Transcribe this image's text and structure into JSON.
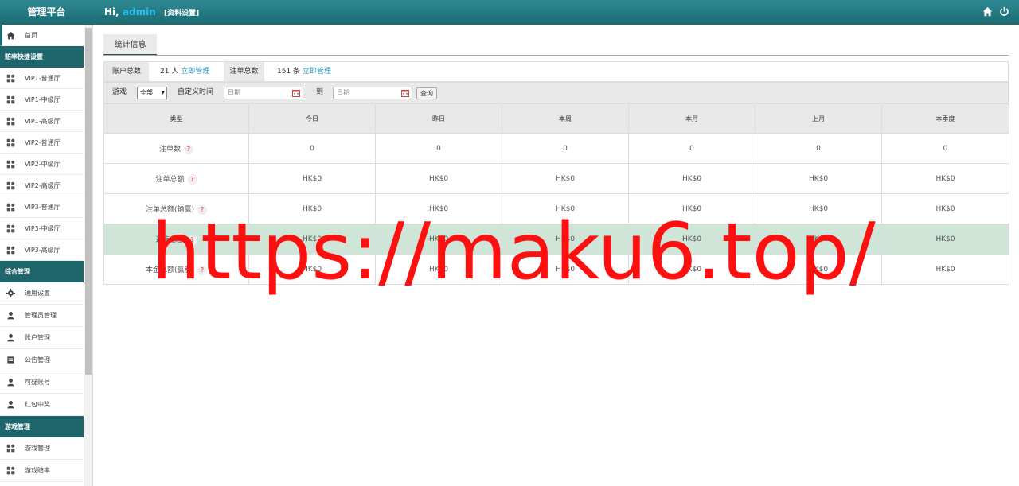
{
  "header": {
    "brand": "管理平台",
    "greeting": "Hi,",
    "user": "admin",
    "profile_link": "[资料设置]"
  },
  "sidebar": {
    "home": "首页",
    "sections": [
      {
        "title": "赔率快捷设置",
        "items": [
          "VIP1-普通厅",
          "VIP1-中级厅",
          "VIP1-高级厅",
          "VIP2-普通厅",
          "VIP2-中级厅",
          "VIP2-高级厅",
          "VIP3-普通厅",
          "VIP3-中级厅",
          "VIP3-高级厅"
        ]
      },
      {
        "title": "综合管理",
        "items": [
          "通用设置",
          "管理员管理",
          "账户管理",
          "公告管理",
          "可疑账号",
          "红包中奖"
        ]
      },
      {
        "title": "游戏管理",
        "items": [
          "游戏管理",
          "游戏赔率"
        ]
      }
    ]
  },
  "tab": "统计信息",
  "summary": {
    "accounts_label": "账户总数",
    "accounts_value": "21 人",
    "accounts_link": "立即管理",
    "orders_label": "注单总数",
    "orders_value": "151 条",
    "orders_link": "立即管理"
  },
  "filter": {
    "game_label": "游戏",
    "game_selected": "全部",
    "custom_time_label": "自定义时间",
    "date_placeholder": "日期",
    "to_label": "到",
    "query_button": "查询"
  },
  "table": {
    "headers": [
      "类型",
      "今日",
      "昨日",
      "本周",
      "本月",
      "上月",
      "本季度"
    ],
    "rows": [
      {
        "label": "注单数",
        "values": [
          "0",
          "0",
          "0",
          "0",
          "0",
          "0"
        ]
      },
      {
        "label": "注单总额",
        "values": [
          "HK$0",
          "HK$0",
          "HK$0",
          "HK$0",
          "HK$0",
          "HK$0"
        ]
      },
      {
        "label": "注单总额(输赢)",
        "values": [
          "HK$0",
          "HK$0",
          "HK$0",
          "HK$0",
          "HK$0",
          "HK$0"
        ]
      },
      {
        "label": "返点总额",
        "values": [
          "HK$0",
          "HK$0",
          "HK$0",
          "HK$0",
          "HK$0",
          "HK$0"
        ]
      },
      {
        "label": "本金总额(赢利)",
        "values": [
          "HK$0",
          "HK$0",
          "HK$0",
          "HK$0",
          "HK$0",
          "HK$0"
        ]
      }
    ],
    "help_mark": "?"
  },
  "watermark": "https://maku6.top/",
  "colors": {
    "header": "#1c6a72",
    "sidebar_head": "#1f666c",
    "link": "#2a8fbd",
    "highlight_row": "#cfe5d7",
    "watermark": "#ff1010"
  }
}
